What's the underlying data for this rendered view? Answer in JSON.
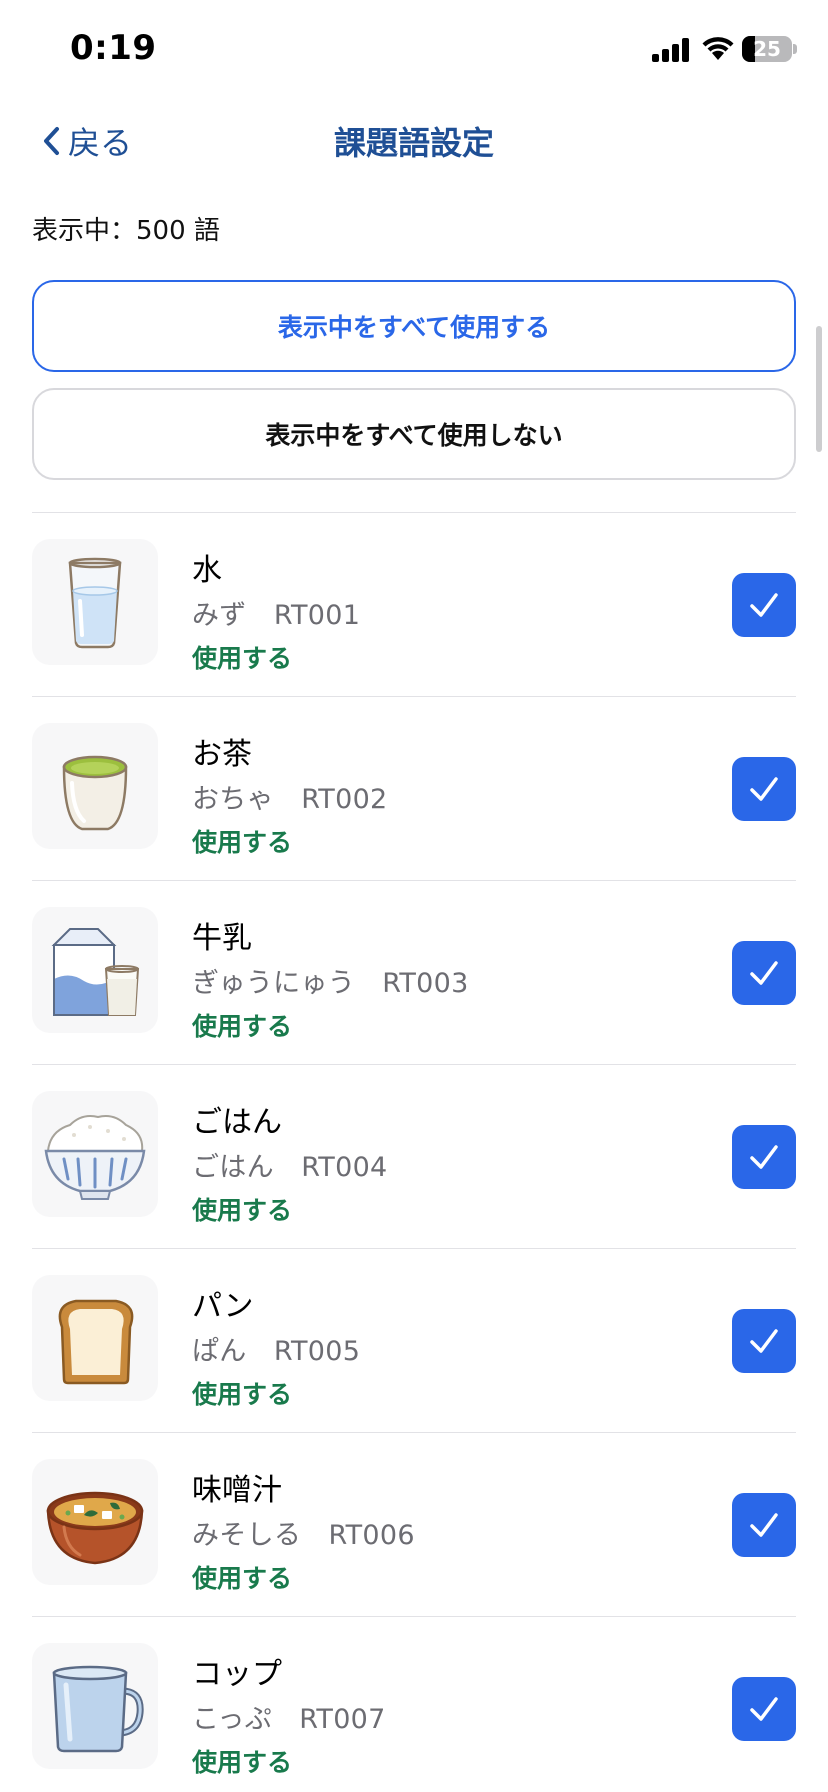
{
  "status_bar": {
    "time": "0:19",
    "battery": "25",
    "battery_level": 0.25
  },
  "nav": {
    "back_label": "戻る",
    "title": "課題語設定"
  },
  "summary": {
    "count_text": "表示中：500 語"
  },
  "actions": {
    "use_all_label": "表示中をすべて使用する",
    "unuse_all_label": "表示中をすべて使用しない"
  },
  "colors": {
    "accent": "#2a67e8",
    "nav_text": "#1f4f95",
    "status_green": "#197a4c"
  },
  "items": [
    {
      "word": "水",
      "reading": "みず　RT001",
      "status": "使用する",
      "checked": true,
      "icon": "water-glass-icon"
    },
    {
      "word": "お茶",
      "reading": "おちゃ　RT002",
      "status": "使用する",
      "checked": true,
      "icon": "green-tea-icon"
    },
    {
      "word": "牛乳",
      "reading": "ぎゅうにゅう　RT003",
      "status": "使用する",
      "checked": true,
      "icon": "milk-icon"
    },
    {
      "word": "ごはん",
      "reading": "ごはん　RT004",
      "status": "使用する",
      "checked": true,
      "icon": "rice-bowl-icon"
    },
    {
      "word": "パン",
      "reading": "ぱん　RT005",
      "status": "使用する",
      "checked": true,
      "icon": "bread-icon"
    },
    {
      "word": "味噌汁",
      "reading": "みそしる　RT006",
      "status": "使用する",
      "checked": true,
      "icon": "miso-soup-icon"
    },
    {
      "word": "コップ",
      "reading": "こっぷ　RT007",
      "status": "使用する",
      "checked": true,
      "icon": "cup-icon"
    }
  ]
}
